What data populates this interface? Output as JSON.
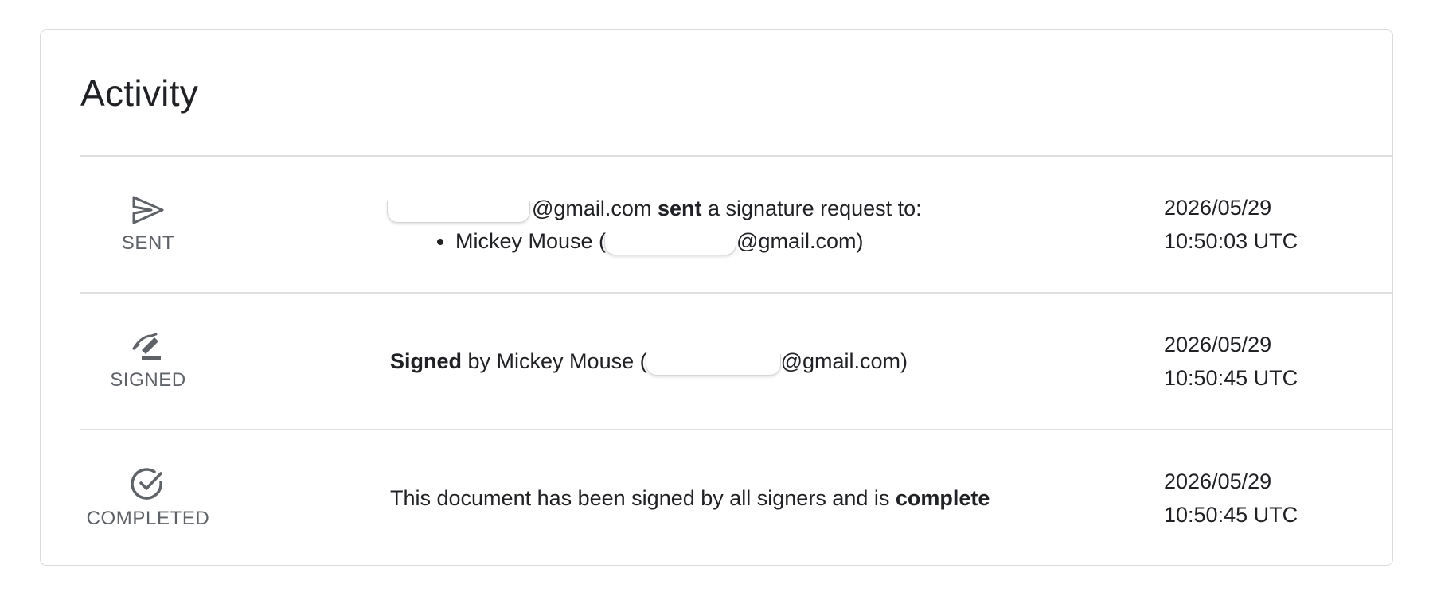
{
  "activity": {
    "title": "Activity",
    "rows": [
      {
        "status_icon": "send-icon",
        "status_label": "SENT",
        "sender_email_suffix": "@gmail.com",
        "action_word": "sent",
        "action_rest": "a signature request to:",
        "recipient_prefix": "Mickey Mouse (",
        "recipient_suffix": "@gmail.com)",
        "date": "2026/05/29",
        "time": "10:50:03 UTC"
      },
      {
        "status_icon": "signature-icon",
        "status_label": "SIGNED",
        "action_word": "Signed",
        "signer_prefix": "by Mickey Mouse (",
        "signer_suffix": "@gmail.com)",
        "date": "2026/05/29",
        "time": "10:50:45 UTC"
      },
      {
        "status_icon": "check-circle-icon",
        "status_label": "COMPLETED",
        "text_before": "This document has been signed by all signers and is",
        "emphasis": "complete",
        "date": "2026/05/29",
        "time": "10:50:45 UTC"
      }
    ]
  },
  "colors": {
    "text": "#202124",
    "muted": "#5f6368",
    "divider": "#e0e0e0",
    "border": "#dadce0"
  }
}
